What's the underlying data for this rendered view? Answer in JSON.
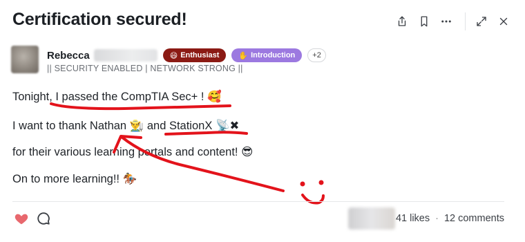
{
  "post": {
    "title": "Certification secured!"
  },
  "toolbar": {
    "icons": [
      "share-icon",
      "bookmark-icon",
      "more-icon",
      "expand-icon",
      "close-icon"
    ]
  },
  "author": {
    "name": "Rebecca",
    "tagline": "|| SECURITY ENABLED | NETWORK STRONG ||",
    "badges": [
      {
        "emoji": "😄",
        "label": "Enthusiast",
        "color": "#8b1a14"
      },
      {
        "emoji": "✋",
        "label": "Introduction",
        "color": "#9c79e0"
      }
    ],
    "more_badges": "+2"
  },
  "content": {
    "line1": {
      "text": "Tonight, I passed the CompTIA Sec+ !",
      "emoji": "🥰"
    },
    "line2": {
      "text1": "I want to thank Nathan",
      "emoji1": "👨‍🌾",
      "text2": "and StationX",
      "emoji2": "📡✖"
    },
    "line3": {
      "text": "for their various learning portals and content!",
      "emoji": "😎"
    },
    "line4": {
      "text": "On to more learning!!",
      "emoji": "🏇"
    }
  },
  "footer": {
    "likes": "41 likes",
    "separator": "·",
    "comments": "12 comments"
  },
  "colors": {
    "annotation_red": "#e3131b",
    "heart": "#e8686e"
  }
}
